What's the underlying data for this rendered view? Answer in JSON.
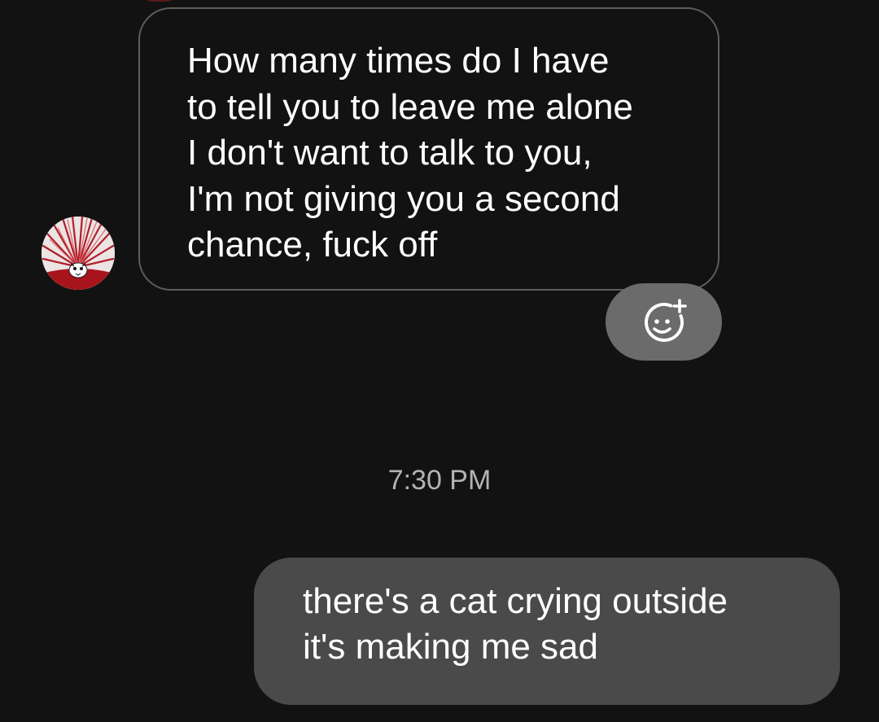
{
  "conversation": {
    "incoming_message": {
      "text": "How many times do I have\nto tell you to leave me alone\nI don't want to talk to you,\nI'm not giving you a second\nchance, fuck off",
      "sender_avatar": "profile-avatar"
    },
    "reaction_button": {
      "icon": "add-reaction-icon"
    },
    "timestamp": "7:30 PM",
    "outgoing_message": {
      "text": "there's a cat crying outside\nit's making me sad"
    }
  },
  "colors": {
    "background": "#121212",
    "incoming_border": "#5e5e5e",
    "outgoing_bubble": "#4a4a4a",
    "reaction_button": "#6b6b6b",
    "timestamp": "#b3b3b3",
    "text": "#ffffff"
  }
}
